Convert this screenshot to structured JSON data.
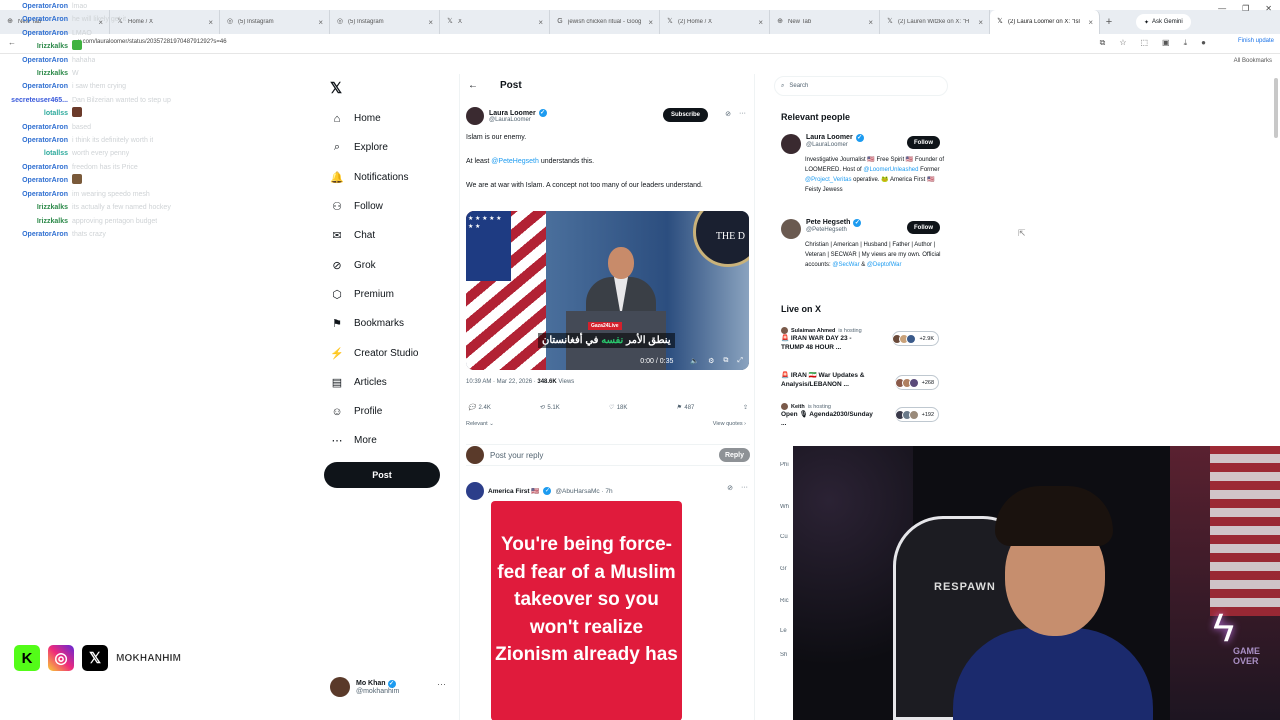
{
  "browser": {
    "tabs": [
      {
        "icon": "⊕",
        "title": "New Tab"
      },
      {
        "icon": "𝕏",
        "title": "Home / X"
      },
      {
        "icon": "◎",
        "title": "(5) Instagram"
      },
      {
        "icon": "◎",
        "title": "(5) Instagram"
      },
      {
        "icon": "𝕏",
        "title": "X"
      },
      {
        "icon": "G",
        "title": "jewish chicken ritual - Goog"
      },
      {
        "icon": "𝕏",
        "title": "(2) Home / X"
      },
      {
        "icon": "⊕",
        "title": "New Tab"
      },
      {
        "icon": "𝕏",
        "title": "(2) Lauren Witzke on X: \"H"
      },
      {
        "icon": "𝕏",
        "title": "(2) Laura Loomer on X: \"Isl"
      }
    ],
    "ask_label": "Ask Gemini",
    "url": "x.com/lauraloomer/status/2035728197048791292?s=46",
    "finish_label": "Finish update",
    "bookmarks_label": "All Bookmarks"
  },
  "chat": [
    {
      "user": "OperatorAron",
      "color": "#2f6fd1",
      "msg": "lmao"
    },
    {
      "user": "OperatorAron",
      "color": "#2f6fd1",
      "msg": "he will likely get it"
    },
    {
      "user": "OperatorAron",
      "color": "#2f6fd1",
      "msg": "LMAO"
    },
    {
      "user": "Irizzkalks",
      "color": "#2d8a4a",
      "msg": "",
      "emote": "#3fb23f"
    },
    {
      "user": "OperatorAron",
      "color": "#2f6fd1",
      "msg": "hahaha"
    },
    {
      "user": "Irizzkalks",
      "color": "#2d8a4a",
      "msg": "W"
    },
    {
      "user": "OperatorAron",
      "color": "#2f6fd1",
      "msg": "i saw them crying"
    },
    {
      "user": "secreteuser465...",
      "color": "#3b5bdb",
      "msg": "Dan Bilzerian wanted to step up"
    },
    {
      "user": "lotallss",
      "color": "#2eaa9c",
      "msg": "",
      "emote": "#6b3a2a"
    },
    {
      "user": "OperatorAron",
      "color": "#2f6fd1",
      "msg": "based"
    },
    {
      "user": "OperatorAron",
      "color": "#2f6fd1",
      "msg": "i think its definitely worth it"
    },
    {
      "user": "lotallss",
      "color": "#2eaa9c",
      "msg": "worth every penny"
    },
    {
      "user": "OperatorAron",
      "color": "#2f6fd1",
      "msg": "freedom has its Price"
    },
    {
      "user": "OperatorAron",
      "color": "#2f6fd1",
      "msg": "",
      "emote": "#7a5a3a"
    },
    {
      "user": "OperatorAron",
      "color": "#2f6fd1",
      "msg": "im wearing speedo mesh"
    },
    {
      "user": "Irizzkalks",
      "color": "#2d8a4a",
      "msg": "its actually a few named hockey"
    },
    {
      "user": "Irizzkalks",
      "color": "#2d8a4a",
      "msg": "approving pentagon budget"
    },
    {
      "user": "OperatorAron",
      "color": "#2f6fd1",
      "msg": "thats crazy"
    }
  ],
  "nav": {
    "items": [
      {
        "icon": "⌂",
        "label": "Home"
      },
      {
        "icon": "⌕",
        "label": "Explore"
      },
      {
        "icon": "🔔",
        "label": "Notifications"
      },
      {
        "icon": "⚇",
        "label": "Follow"
      },
      {
        "icon": "✉",
        "label": "Chat"
      },
      {
        "icon": "⊘",
        "label": "Grok"
      },
      {
        "icon": "⬡",
        "label": "Premium"
      },
      {
        "icon": "⚑",
        "label": "Bookmarks"
      },
      {
        "icon": "⚡",
        "label": "Creator Studio"
      },
      {
        "icon": "▤",
        "label": "Articles"
      },
      {
        "icon": "☺",
        "label": "Profile"
      },
      {
        "icon": "⋯",
        "label": "More"
      }
    ],
    "post_label": "Post",
    "account": {
      "name": "Mo Khan",
      "handle": "@mokhanhim"
    }
  },
  "social": {
    "handle": "MOKHANHIM"
  },
  "post": {
    "header": "Post",
    "author": {
      "name": "Laura Loomer",
      "handle": "@LauraLoomer"
    },
    "subscribe_label": "Subscribe",
    "line1": "Islam is our enemy.",
    "line2_prefix": "At least ",
    "line2_mention": "@PeteHegseth",
    "line2_suffix": " understands this.",
    "line3": "We are at war with Islam. A concept not too many of our leaders understand.",
    "video": {
      "badge": "Gaza24Live",
      "caption_a": "ينطق الأمر ",
      "caption_hl": "نفسه",
      "caption_b": " في أفغانستان",
      "time": "0:00 / 0:35",
      "seal_text": "THE D"
    },
    "meta_time": "10:39 AM · Mar 22, 2026 · ",
    "meta_views": "348.6K",
    "meta_views_label": " Views",
    "stats": {
      "replies": "2.4K",
      "reposts": "5.1K",
      "likes": "18K",
      "bookmarks": "487"
    },
    "relevant_label": "Relevant ⌄",
    "view_quotes_label": "View quotes ›",
    "reply_placeholder": "Post your reply",
    "reply_label": "Reply"
  },
  "reply_tweet": {
    "name": "America First 🇺🇸",
    "handle": "@AbuHarsaMc · 7h",
    "card_text": "You're being force-fed fear of a Muslim takeover so you won't realize Zionism already has"
  },
  "right": {
    "search_placeholder": "Search",
    "relevant_title": "Relevant people",
    "people": [
      {
        "name": "Laura Loomer",
        "handle": "@LauraLoomer",
        "follow": "Follow",
        "bio_a": "Investigative Journalist 🇺🇸 Free Spirit 🇺🇸 Founder of LOOMERED. Host of ",
        "bio_link1": "@LoomerUnleashed",
        "bio_b": " Former ",
        "bio_link2": "@Project_Veritas",
        "bio_c": " operative. 🐸 America First 🇺🇸 Feisty Jewess"
      },
      {
        "name": "Pete Hegseth",
        "handle": "@PeteHegseth",
        "follow": "Follow",
        "bio_a": "Christian | American | Husband | Father | Author | Veteran | SECWAR | My views are my own. Official accounts: ",
        "bio_link1": "@SecWar",
        "bio_b": " & ",
        "bio_link2": "@DeptofWar",
        "bio_c": ""
      }
    ],
    "live_title": "Live on X",
    "live": [
      {
        "host": "Sulaiman Ahmed",
        "status": "is hosting",
        "title": "🚨 IRAN WAR DAY 23 - TRUMP 48 HOUR ...",
        "count": "+2.9K",
        "dots": [
          "#6a4a3a",
          "#c9a27a",
          "#3a5a8a"
        ]
      },
      {
        "host": "",
        "status": "",
        "title": "🚨 IRAN 🇮🇷 War Updates & Analysis/LEBANON ...",
        "count": "+268",
        "dots": [
          "#8a5a4a",
          "#b08060",
          "#5a4a7a"
        ]
      },
      {
        "host": "Keith",
        "status": "is hosting",
        "title": "Open 🎙 Agenda2030/Sunday ...",
        "count": "+192",
        "dots": [
          "#3a3a4a",
          "#6a7a8a",
          "#9a8a7a"
        ]
      }
    ],
    "peek": [
      "Phi",
      "Wh",
      "Cu",
      "Gr",
      "Ric",
      "Le",
      "Sh"
    ]
  },
  "webcam": {
    "chair_brand": "RESPAWN",
    "game_over": "GAME OVER"
  }
}
